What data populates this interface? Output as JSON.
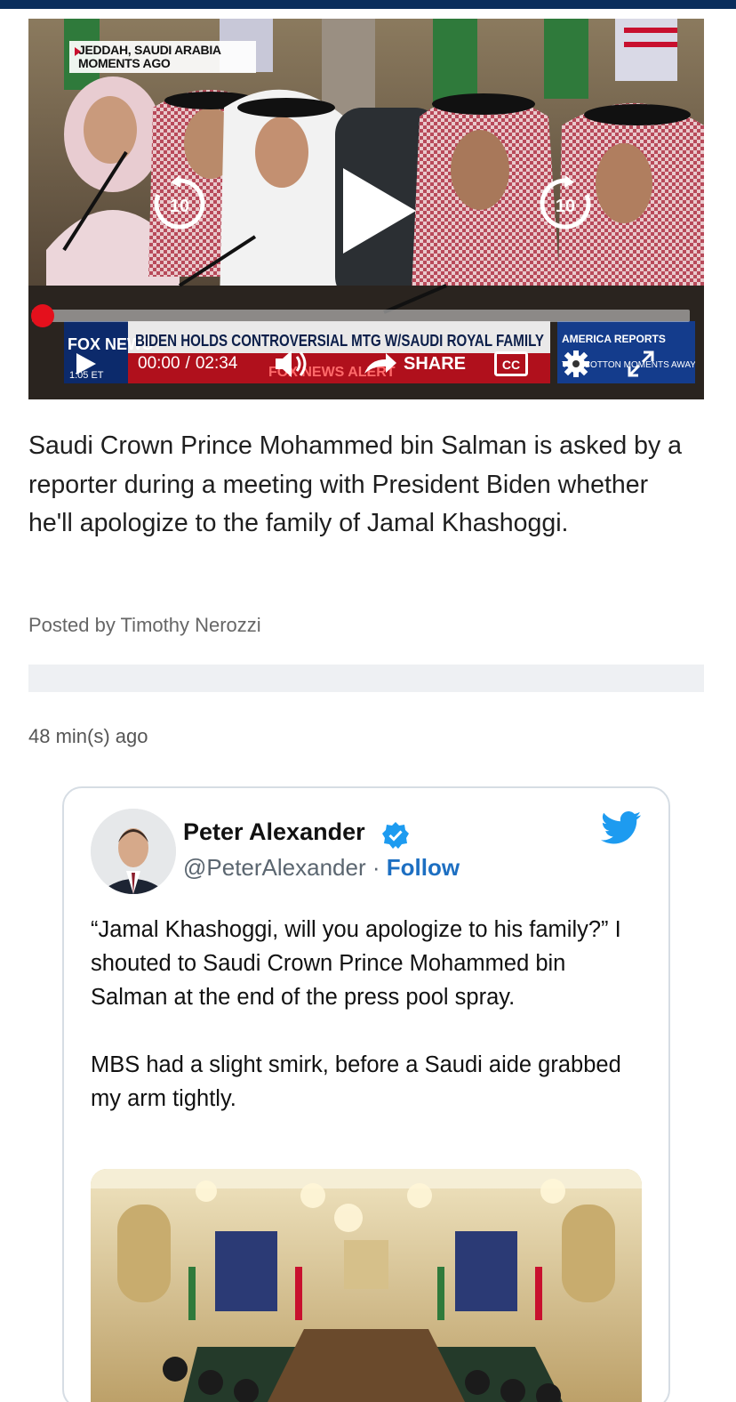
{
  "video": {
    "location_line1": "JEDDAH, SAUDI ARABIA",
    "location_line2": "MOMENTS AGO",
    "ticker_network": "FOX NEWS",
    "ticker_time": "1:05 ET",
    "ticker_headline": "BIDEN HOLDS CONTROVERSIAL MTG W/SAUDI ROYAL FAMILY",
    "ticker_alert": "FOX NEWS ALERT",
    "ticker_show": "AMERICA REPORTS",
    "ticker_show_sub": "TOM COTTON MOMENTS AWAY",
    "skip_back_seconds": "10",
    "skip_forward_seconds": "10",
    "current_time": "00:00",
    "time_separator": "/",
    "duration": "02:34",
    "share_label": "SHARE",
    "cc_label": "CC",
    "progress_fraction": 0,
    "accent_color": "#e4101c"
  },
  "article": {
    "caption": "Saudi Crown Prince Mohammed bin Salman is asked by a reporter during a meeting with President Biden whether he'll apologize to the family of Jamal Khashoggi.",
    "byline": "Posted by Timothy Nerozzi",
    "timestamp": "48 min(s) ago"
  },
  "tweet": {
    "author_name": "Peter Alexander",
    "handle": "@PeterAlexander",
    "separator": "·",
    "follow_label": "Follow",
    "paragraph1": "“Jamal Khashoggi, will you apologize to his family?” I shouted to Saudi Crown Prince Mohammed bin Salman at the end of the press pool spray.",
    "paragraph2": "MBS had a slight smirk, before a Saudi aide grabbed my arm tightly.",
    "brand_color": "#1d9bf0",
    "icons": [
      "verified-badge-icon",
      "twitter-bird-icon"
    ]
  }
}
